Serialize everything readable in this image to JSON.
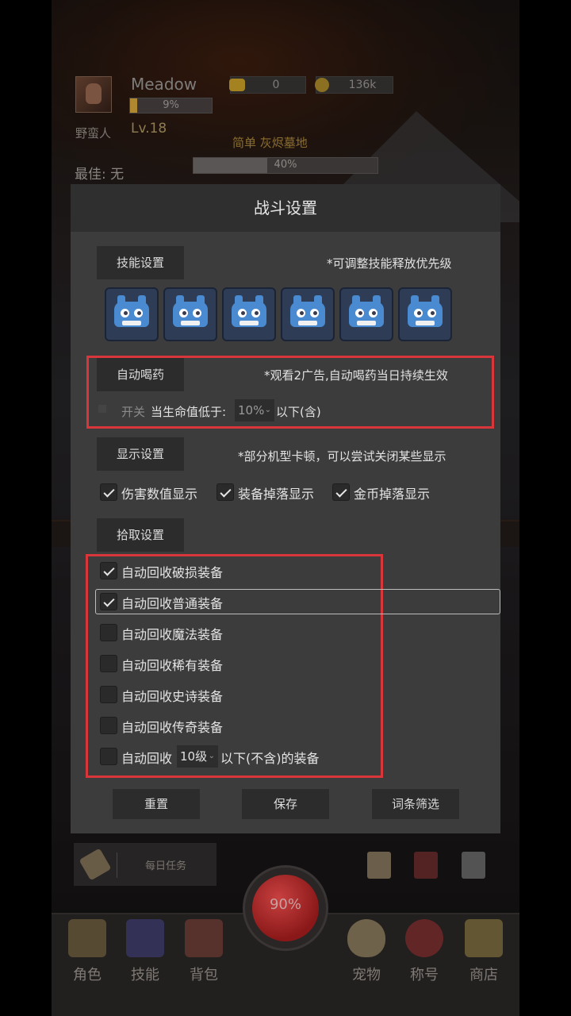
{
  "player": {
    "name": "Meadow",
    "class_name": "野蛮人",
    "level": "Lv.18",
    "xp_percent_label": "9%",
    "xp_progress": 0.09,
    "gold": "0",
    "coins": "136k",
    "difficulty": "简单  灰烬墓地",
    "best_label": "最佳: 无",
    "stage_percent_label": "40%",
    "stage_progress": 0.4
  },
  "dialog": {
    "title": "战斗设置",
    "skills": {
      "button": "技能设置",
      "note": "*可调整技能释放优先级",
      "slots": [
        "godot-icon",
        "godot-icon",
        "godot-icon",
        "godot-icon",
        "godot-icon",
        "godot-icon"
      ]
    },
    "potion": {
      "button": "自动喝药",
      "note": "*观看2广告,自动喝药当日持续生效",
      "switch_label": "开关",
      "condition_label": "当生命值低于:",
      "threshold": "10%",
      "suffix": "以下(含)"
    },
    "display": {
      "button": "显示设置",
      "note": "*部分机型卡顿，可以尝试关闭某些显示",
      "options": [
        {
          "label": "伤害数值显示",
          "checked": true
        },
        {
          "label": "装备掉落显示",
          "checked": true
        },
        {
          "label": "金币掉落显示",
          "checked": true
        }
      ]
    },
    "pickup": {
      "button": "拾取设置",
      "options": [
        {
          "label": "自动回收破损装备",
          "checked": true
        },
        {
          "label": "自动回收普通装备",
          "checked": true
        },
        {
          "label": "自动回收魔法装备",
          "checked": false
        },
        {
          "label": "自动回收稀有装备",
          "checked": false
        },
        {
          "label": "自动回收史诗装备",
          "checked": false
        },
        {
          "label": "自动回收传奇装备",
          "checked": false
        }
      ],
      "level_prefix": "自动回收",
      "level_value": "10级",
      "level_suffix": "以下(不含)的装备",
      "level_checked": false
    },
    "footer": {
      "reset": "重置",
      "save": "保存",
      "filter": "词条筛选"
    }
  },
  "bottom": {
    "daily_task": "每日任务",
    "hp_orb": "90%",
    "nav": [
      "角色",
      "技能",
      "背包",
      "宠物",
      "称号",
      "商店"
    ]
  },
  "colors": {
    "highlight_border": "#d8363b",
    "dialog_bg": "#3c3c3c",
    "button_bg": "#2c2c2c"
  }
}
